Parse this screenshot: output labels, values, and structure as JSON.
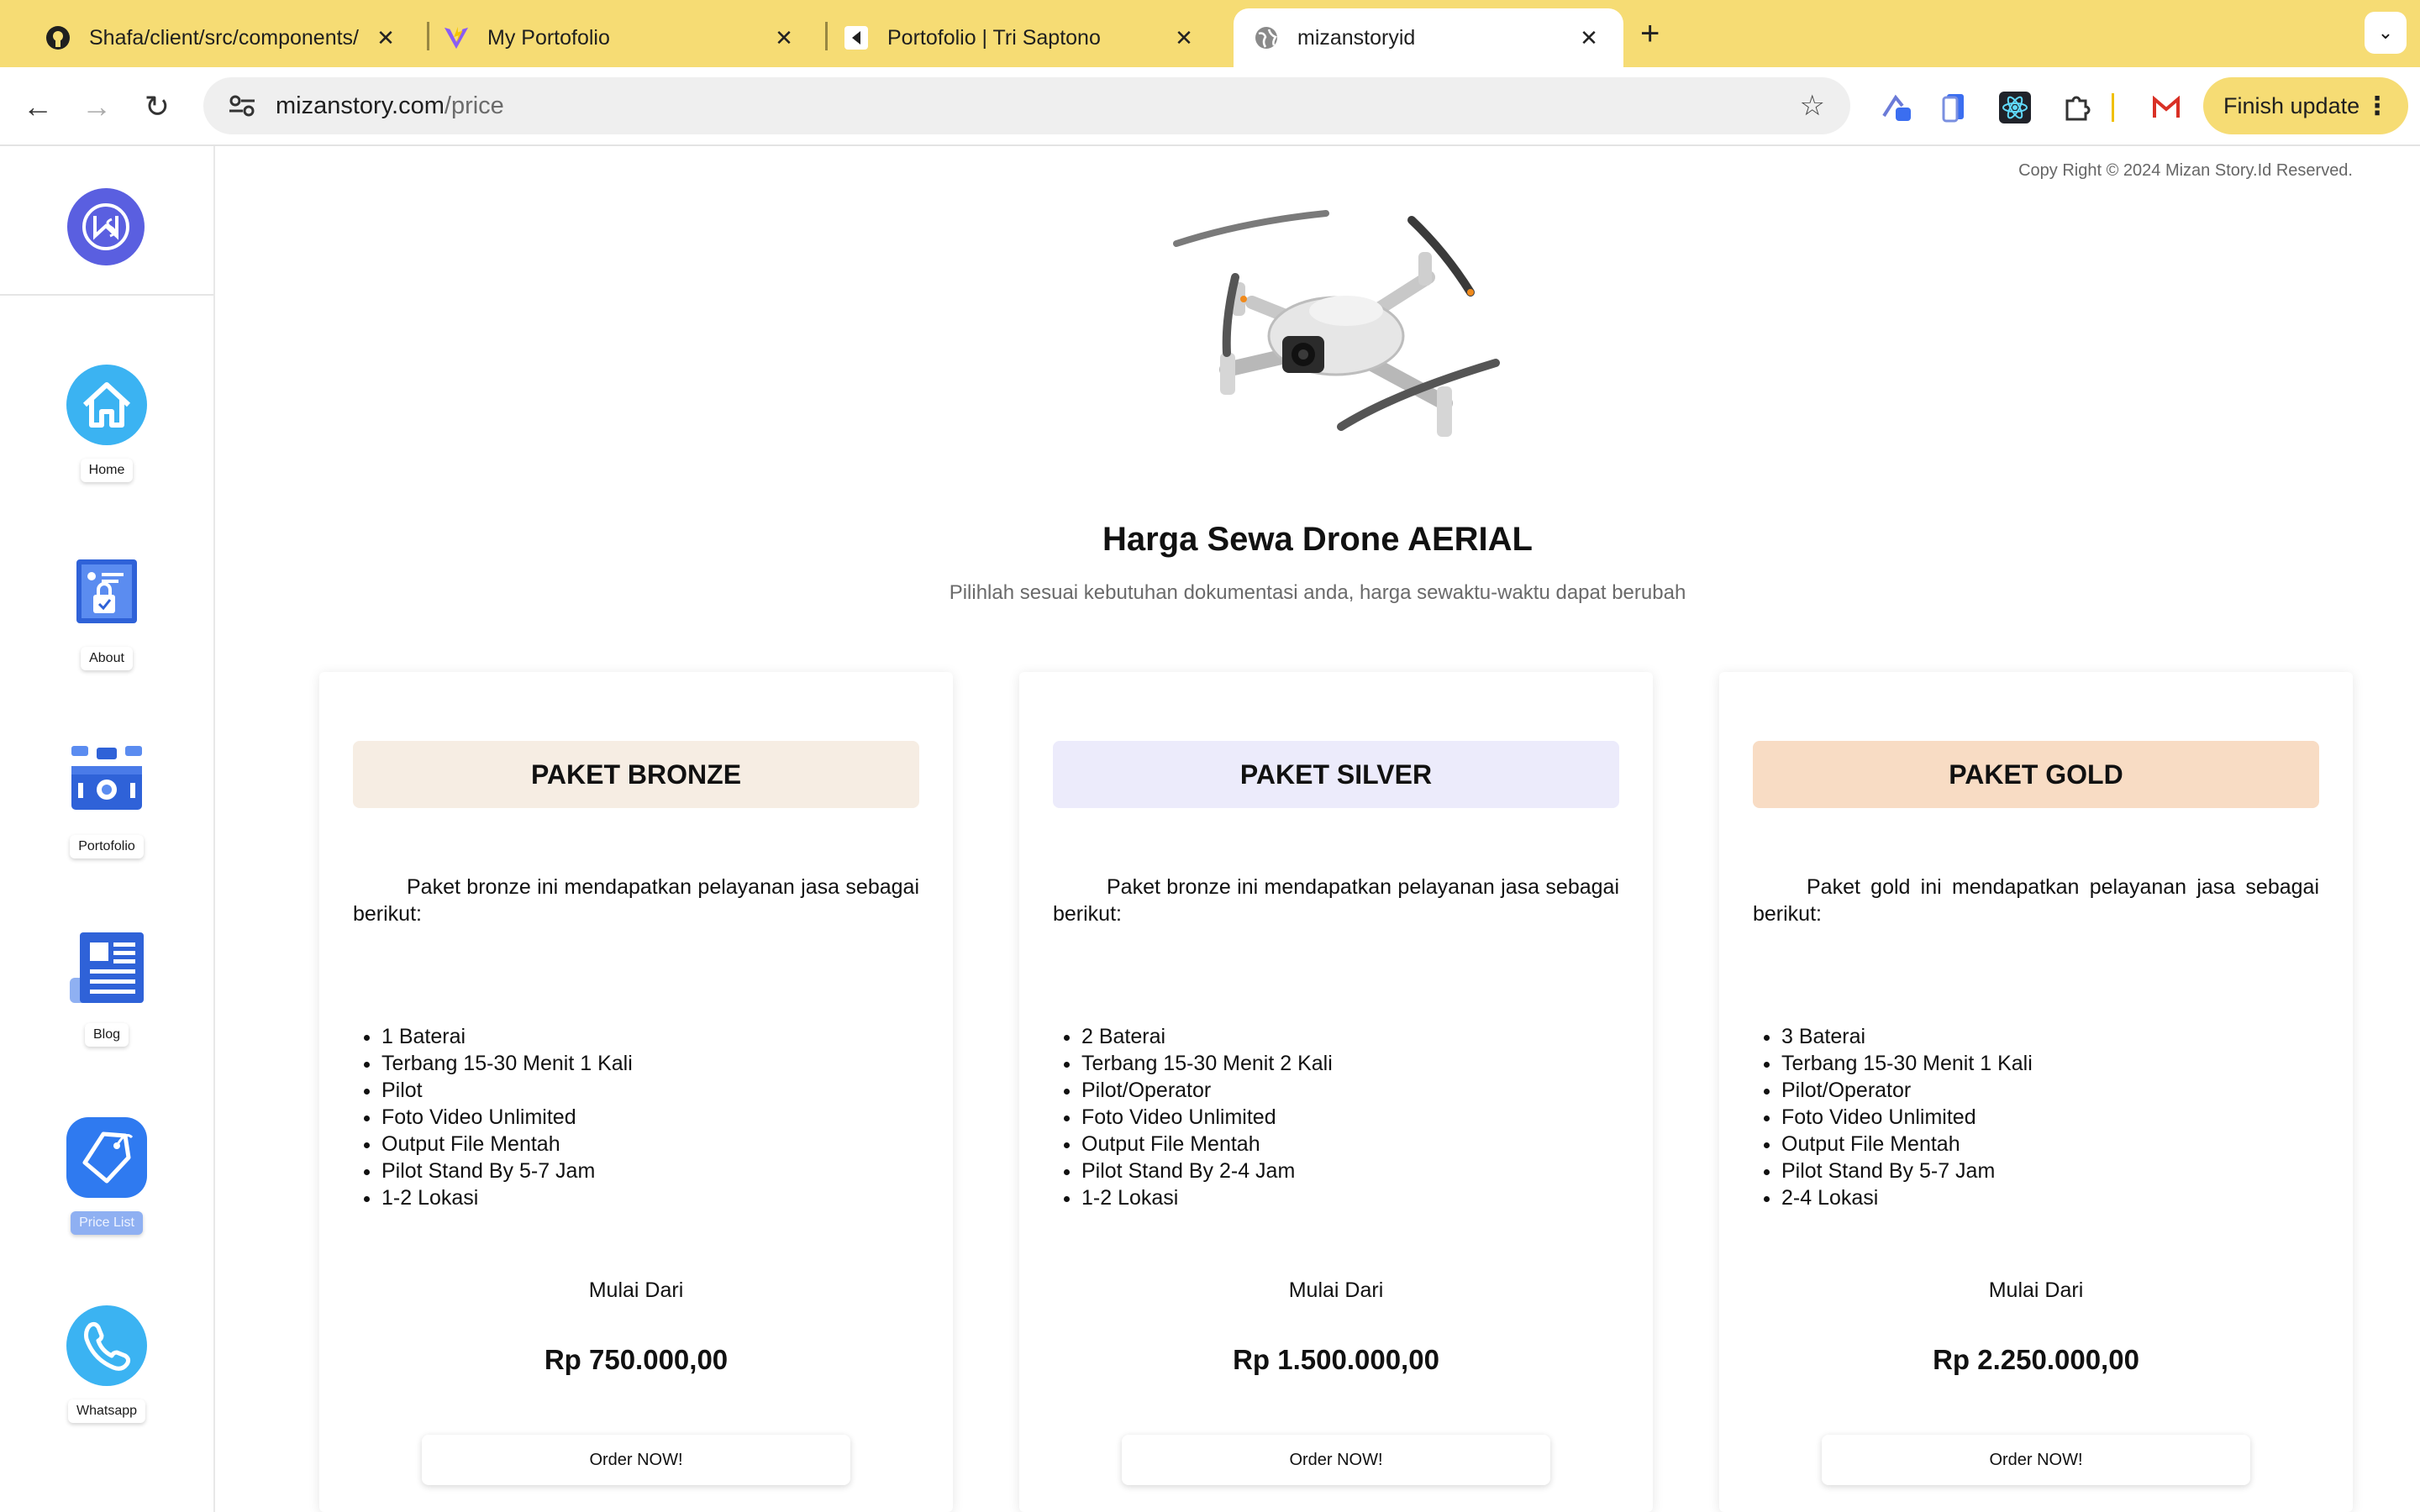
{
  "browser": {
    "tabs": [
      {
        "title": "Shafa/client/src/components/",
        "icon": "github-icon"
      },
      {
        "title": "My Portofolio",
        "icon": "vite-icon"
      },
      {
        "title": "Portofolio | Tri Saptono",
        "icon": "site-icon"
      },
      {
        "title": "mizanstoryid",
        "icon": "globe-icon"
      }
    ],
    "url_domain": "mizanstory.com",
    "url_path": "/price",
    "update_button": "Finish update",
    "accent_color": "#f6dc74"
  },
  "sidebar": {
    "items": [
      {
        "label": "Home",
        "icon": "home-icon"
      },
      {
        "label": "About",
        "icon": "about-icon"
      },
      {
        "label": "Portofolio",
        "icon": "portfolio-icon"
      },
      {
        "label": "Blog",
        "icon": "blog-icon"
      },
      {
        "label": "Price List",
        "icon": "price-tag-icon"
      },
      {
        "label": "Whatsapp",
        "icon": "phone-icon"
      }
    ],
    "active_item": "Price List"
  },
  "page": {
    "copyright": "Copy Right © 2024 Mizan Story.Id Reserved.",
    "title": "Harga Sewa Drone AERIAL",
    "subtitle": "Pilihlah sesuai kebutuhan dokumentasi anda, harga sewaktu-waktu dapat berubah"
  },
  "packages": [
    {
      "name": "PAKET BRONZE",
      "header_color": "#f6ede3",
      "description": "Paket bronze ini mendapatkan pelayanan jasa sebagai berikut:",
      "features": [
        "1 Baterai",
        "Terbang 15-30 Menit 1 Kali",
        "Pilot",
        "Foto Video Unlimited",
        "Output File Mentah",
        "Pilot Stand By 5-7 Jam",
        "1-2 Lokasi"
      ],
      "price_label": "Mulai Dari",
      "price": "Rp 750.000,00",
      "button": "Order NOW!"
    },
    {
      "name": "PAKET SILVER",
      "header_color": "#ecebfb",
      "description": "Paket bronze ini mendapatkan pelayanan jasa sebagai berikut:",
      "features": [
        "2 Baterai",
        "Terbang 15-30 Menit 2 Kali",
        "Pilot/Operator",
        "Foto Video Unlimited",
        "Output File Mentah",
        "Pilot Stand By 2-4 Jam",
        "1-2 Lokasi"
      ],
      "price_label": "Mulai Dari",
      "price": "Rp 1.500.000,00",
      "button": "Order NOW!"
    },
    {
      "name": "PAKET GOLD",
      "header_color": "#f8dcc4",
      "description": "Paket gold ini mendapatkan pelayanan jasa sebagai berikut:",
      "features": [
        "3 Baterai",
        "Terbang 15-30 Menit 1 Kali",
        "Pilot/Operator",
        "Foto Video Unlimited",
        "Output File Mentah",
        "Pilot Stand By 5-7 Jam",
        "2-4 Lokasi"
      ],
      "price_label": "Mulai Dari",
      "price": "Rp 2.250.000,00",
      "button": "Order NOW!"
    }
  ]
}
